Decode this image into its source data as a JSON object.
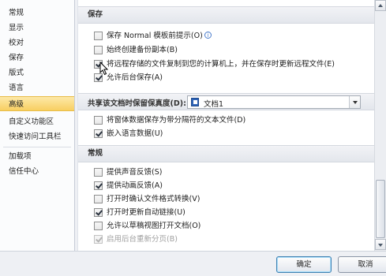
{
  "sidebar": {
    "items": [
      {
        "label": "常规"
      },
      {
        "label": "显示"
      },
      {
        "label": "校对"
      },
      {
        "label": "保存"
      },
      {
        "label": "版式"
      },
      {
        "label": "语言"
      },
      {
        "label": "高级"
      },
      {
        "label": "自定义功能区"
      },
      {
        "label": "快速访问工具栏"
      },
      {
        "label": "加载项"
      },
      {
        "label": "信任中心"
      }
    ],
    "active_index": 6
  },
  "save_section": {
    "title": "保存",
    "options": [
      {
        "label": "保存 Normal 模板前提示(O)",
        "checked": false,
        "has_info_icon": true,
        "info_icon": "info-icon"
      },
      {
        "label": "始终创建备份副本(B)",
        "checked": false
      },
      {
        "label": "将远程存储的文件复制到您的计算机上，并在保存时更新远程文件(E)",
        "checked": true
      },
      {
        "label": "允许后台保存(A)",
        "checked": true
      }
    ]
  },
  "fidelity_section": {
    "label": "共享该文档时保留保真度(D):",
    "selected_doc": "文档1",
    "doc_icon": "word-document-icon",
    "options": [
      {
        "label": "将窗体数据保存为带分隔符的文本文件(D)",
        "checked": false
      },
      {
        "label": "嵌入语言数据(U)",
        "checked": true
      }
    ]
  },
  "general_section": {
    "title": "常规",
    "options": [
      {
        "label": "提供声音反馈(S)",
        "checked": false,
        "disabled": false
      },
      {
        "label": "提供动画反馈(A)",
        "checked": true,
        "disabled": false
      },
      {
        "label": "打开时确认文件格式转换(V)",
        "checked": false,
        "disabled": false
      },
      {
        "label": "打开时更新自动链接(U)",
        "checked": true,
        "disabled": false
      },
      {
        "label": "允许以草稿视图打开文档(O)",
        "checked": false,
        "disabled": false
      },
      {
        "label": "启用后台重新分页(B)",
        "checked": true,
        "disabled": true
      }
    ]
  },
  "scrollbar": {
    "position_fraction": 0.78
  },
  "footer": {
    "ok_label": "确定",
    "cancel_label": "取消"
  },
  "colors": {
    "active_nav": "#f8cf62",
    "section_header": "#e3e6ec",
    "ok_button_border": "#3c7fb1"
  }
}
